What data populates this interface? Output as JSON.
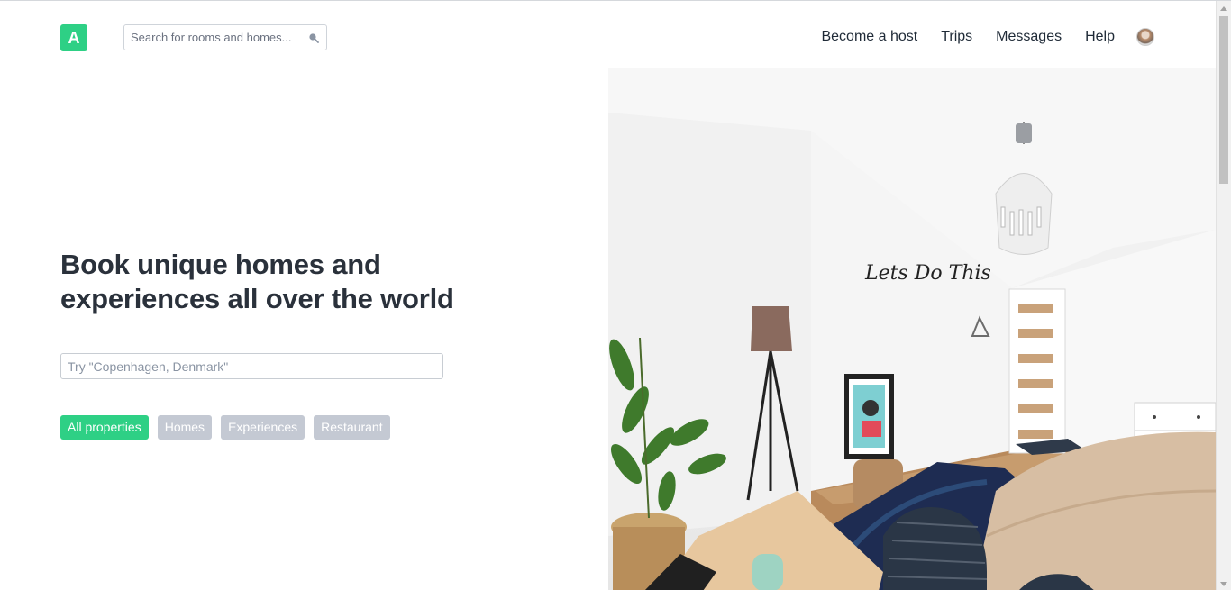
{
  "header": {
    "logo_letter": "A",
    "search": {
      "placeholder": "Search for rooms and homes...",
      "value": ""
    },
    "nav": [
      "Become a host",
      "Trips",
      "Messages",
      "Help"
    ]
  },
  "hero": {
    "title": "Book unique homes and experiences all over the world",
    "search": {
      "placeholder": "Try \"Copenhagen, Denmark\"",
      "value": ""
    },
    "filters": [
      {
        "label": "All properties",
        "active": true
      },
      {
        "label": "Homes",
        "active": false
      },
      {
        "label": "Experiences",
        "active": false
      },
      {
        "label": "Restaurant",
        "active": false
      }
    ]
  },
  "room_image": {
    "wall_lettering": "Lets Do This"
  },
  "colors": {
    "brand": "#2ed085",
    "inactive_filter": "#c4c9d3",
    "text": "#2a313b"
  }
}
